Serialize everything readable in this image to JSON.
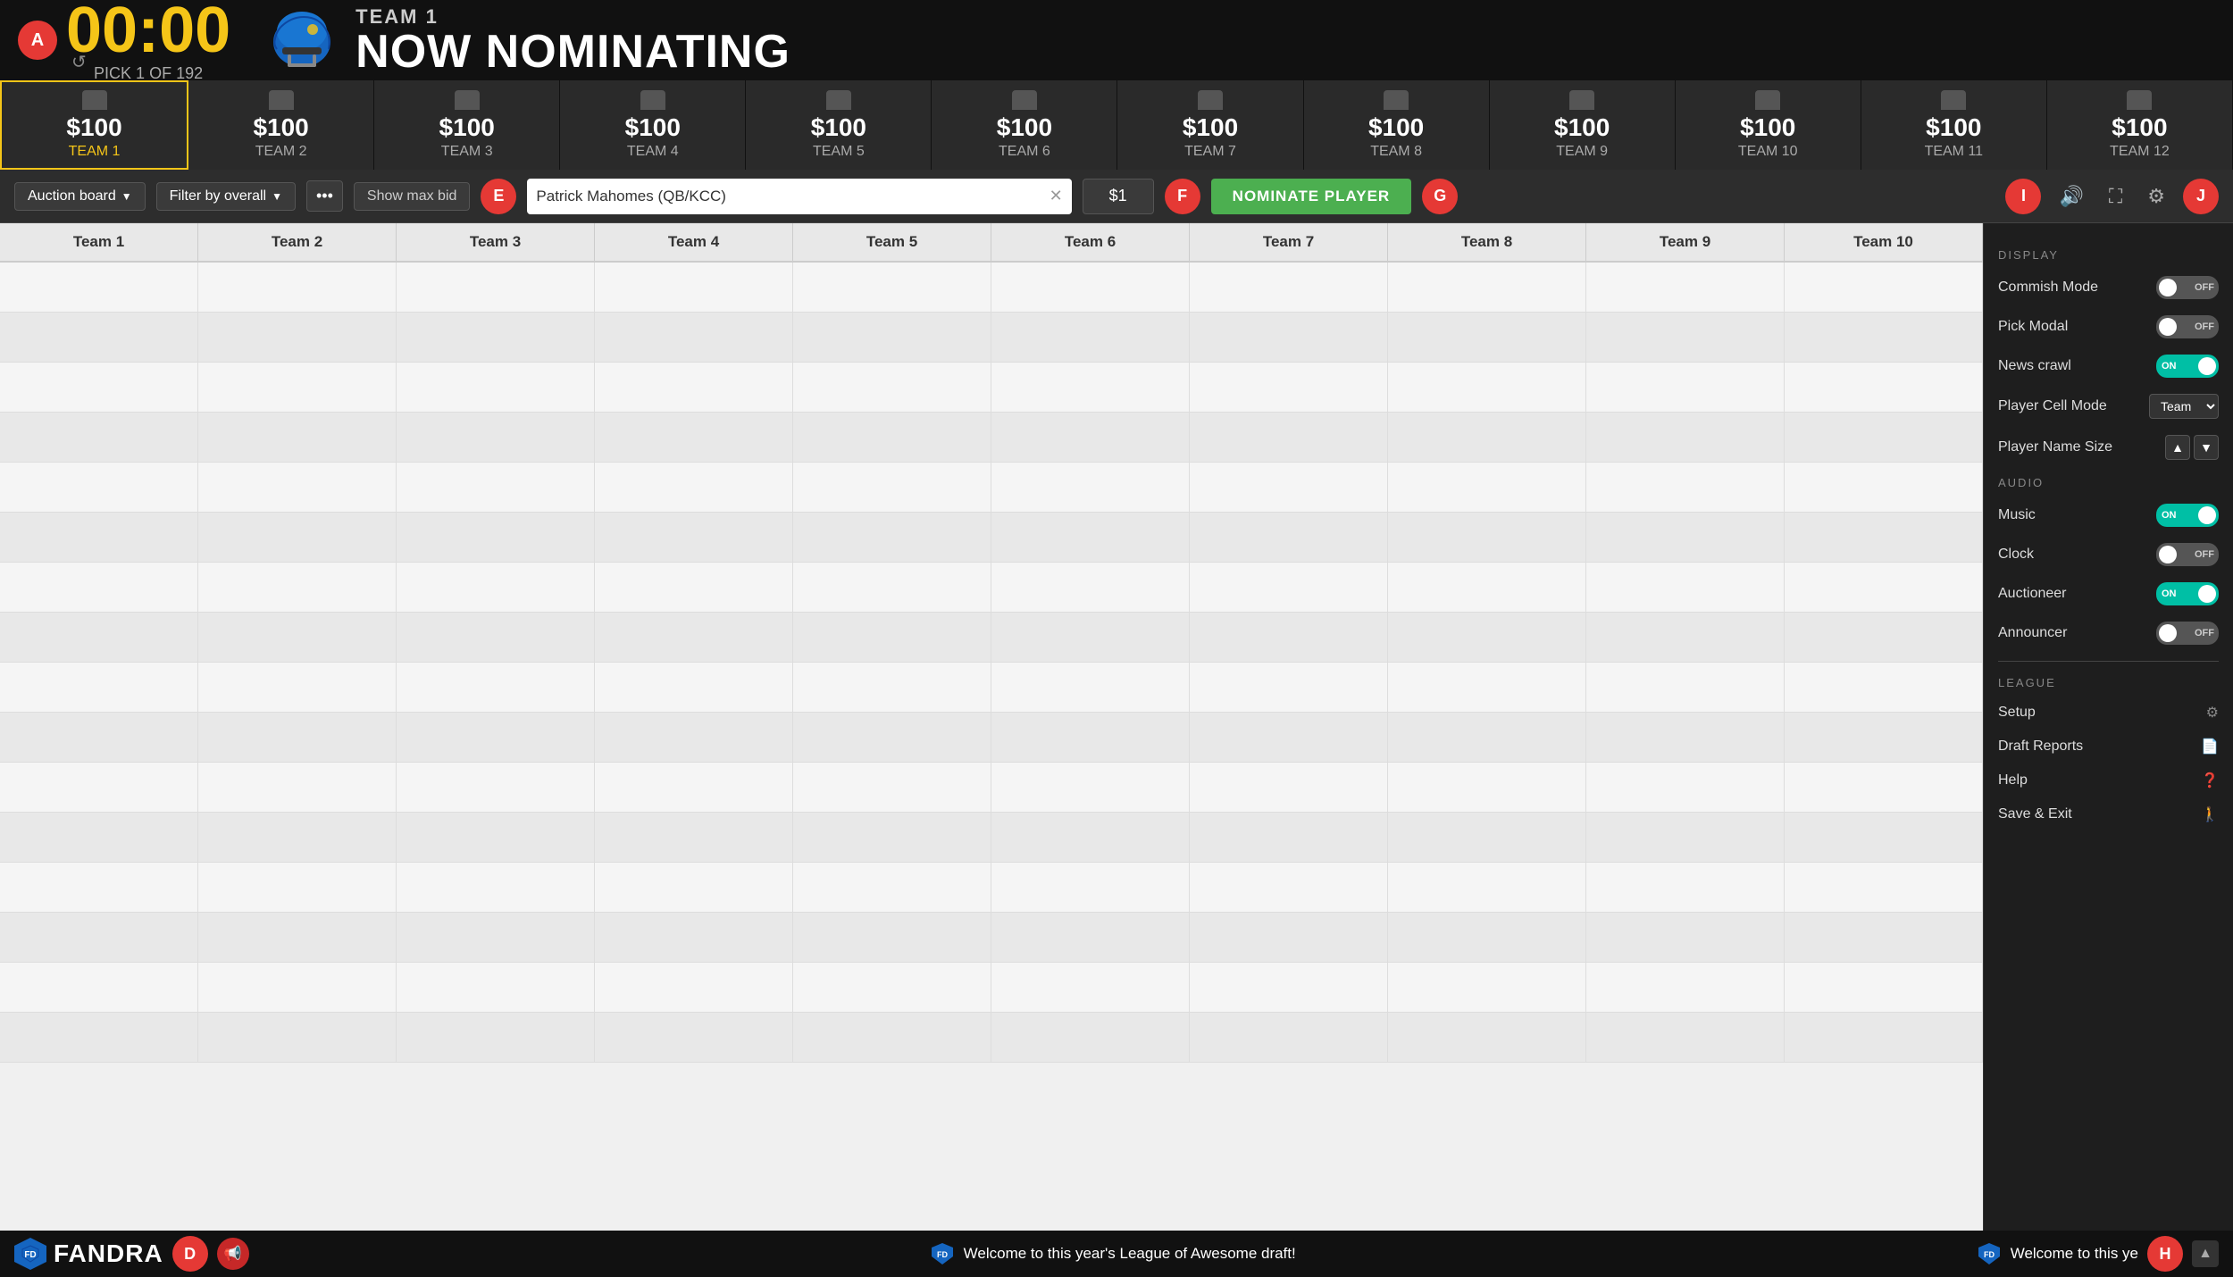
{
  "header": {
    "badge_a": "A",
    "timer": "00:00",
    "pick_info": "PICK 1 OF 192",
    "team_label": "TEAM 1",
    "nominating_label": "NOW NOMINATING",
    "reset_icon": "↺"
  },
  "budget_bar": {
    "teams": [
      {
        "amount": "$100",
        "name": "TEAM 1",
        "active": true
      },
      {
        "amount": "$100",
        "name": "TEAM 2",
        "active": false
      },
      {
        "amount": "$100",
        "name": "TEAM 3",
        "active": false
      },
      {
        "amount": "$100",
        "name": "TEAM 4",
        "active": false
      },
      {
        "amount": "$100",
        "name": "TEAM 5",
        "active": false
      },
      {
        "amount": "$100",
        "name": "TEAM 6",
        "active": false
      },
      {
        "amount": "$100",
        "name": "TEAM 7",
        "active": false
      },
      {
        "amount": "$100",
        "name": "TEAM 8",
        "active": false
      },
      {
        "amount": "$100",
        "name": "TEAM 9",
        "active": false
      },
      {
        "amount": "$100",
        "name": "TEAM 10",
        "active": false
      },
      {
        "amount": "$100",
        "name": "TEAM 11",
        "active": false
      },
      {
        "amount": "$100",
        "name": "TEAM 12",
        "active": false
      }
    ]
  },
  "toolbar": {
    "badge_e": "E",
    "badge_f": "F",
    "badge_g": "G",
    "badge_i": "I",
    "badge_j": "J",
    "auction_board_label": "Auction board",
    "filter_label": "Filter by overall",
    "dots_label": "•••",
    "show_max_bid": "Show max bid",
    "player_search_value": "Patrick Mahomes (QB/KCC)",
    "bid_value": "$1",
    "nominate_btn": "NOMINATE PLAYER",
    "volume_icon": "🔊",
    "fullscreen_icon": "⛶",
    "settings_icon": "⚙"
  },
  "column_headers": [
    "Team 1",
    "Team 2",
    "Team 3",
    "Team 4",
    "Team 5",
    "Team 6",
    "Team 7",
    "Team 8",
    "Team 9",
    "Team 10"
  ],
  "draft_rows": 16,
  "settings_panel": {
    "display_title": "DISPLAY",
    "commish_mode_label": "Commish Mode",
    "commish_mode_on": false,
    "pick_modal_label": "Pick Modal",
    "pick_modal_on": false,
    "news_crawl_label": "News crawl",
    "news_crawl_on": true,
    "player_cell_mode_label": "Player Cell Mode",
    "player_cell_mode_value": "Team",
    "player_name_size_label": "Player Name Size",
    "audio_title": "AUDIO",
    "music_label": "Music",
    "music_on": true,
    "clock_label": "Clock",
    "clock_on": false,
    "auctioneer_label": "Auctioneer",
    "auctioneer_on": true,
    "announcer_label": "Announcer",
    "announcer_on": false,
    "league_title": "LEAGUE",
    "setup_label": "Setup",
    "draft_reports_label": "Draft Reports",
    "help_label": "Help",
    "save_exit_label": "Save & Exit"
  },
  "footer": {
    "badge_d": "D",
    "badge_h": "H",
    "logo_text": "FANDRA",
    "ticker_text": "Welcome to this year's League of Awesome draft!",
    "ticker_text_right": "Welcome to this ye"
  }
}
